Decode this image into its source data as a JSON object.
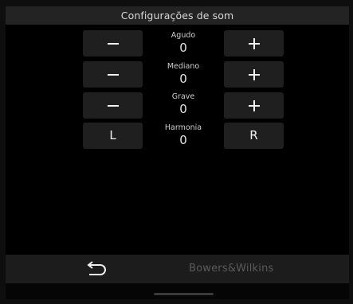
{
  "header": {
    "title": "Configurações de som"
  },
  "settings": [
    {
      "label": "Agudo",
      "value": "0",
      "left_button": "minus",
      "right_button": "plus"
    },
    {
      "label": "Mediano",
      "value": "0",
      "left_button": "minus",
      "right_button": "plus"
    },
    {
      "label": "Grave",
      "value": "0",
      "left_button": "minus",
      "right_button": "plus"
    },
    {
      "label": "Harmonia",
      "value": "0",
      "left_label": "L",
      "right_label": "R"
    }
  ],
  "footer": {
    "back_icon": "return-arrow-icon",
    "brand": "Bowers&Wilkins"
  },
  "colors": {
    "background": "#000000",
    "header_bg": "#232323",
    "button_bg": "#1f1f1f",
    "footer_bg": "#1c1c1c",
    "brand_text": "#5a5a5a"
  }
}
